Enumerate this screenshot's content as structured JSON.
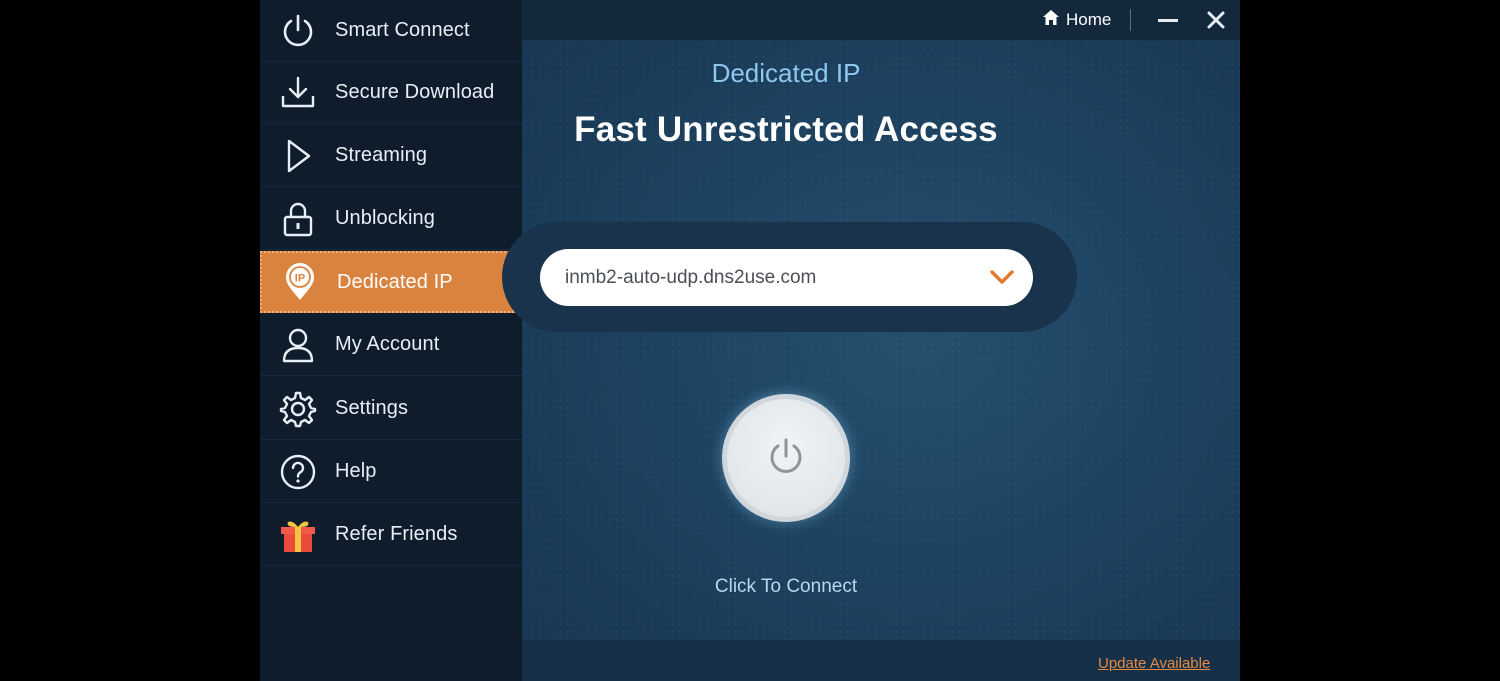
{
  "sidebar": {
    "items": [
      {
        "label": "Smart Connect",
        "icon": "power-icon"
      },
      {
        "label": "Secure Download",
        "icon": "download-icon"
      },
      {
        "label": "Streaming",
        "icon": "play-icon"
      },
      {
        "label": "Unblocking",
        "icon": "lock-icon"
      },
      {
        "label": "Dedicated IP",
        "icon": "ip-pin-icon",
        "active": true
      },
      {
        "label": "My Account",
        "icon": "user-icon"
      },
      {
        "label": "Settings",
        "icon": "gear-icon"
      },
      {
        "label": "Help",
        "icon": "help-icon"
      },
      {
        "label": "Refer Friends",
        "icon": "gift-icon"
      }
    ],
    "active_color": "#d9833f"
  },
  "titlebar": {
    "home_label": "Home"
  },
  "main": {
    "section_title": "Dedicated IP",
    "hero_title": "Fast Unrestricted Access",
    "server": {
      "value": "inmb2-auto-udp.dns2use.com"
    },
    "connect_label": "Click To Connect",
    "update_link": "Update Available"
  },
  "colors": {
    "accent": "#d9833f",
    "sidebar_bg": "#0f1c2c",
    "main_bg": "#1d4260",
    "section_title": "#8fc7ee"
  }
}
